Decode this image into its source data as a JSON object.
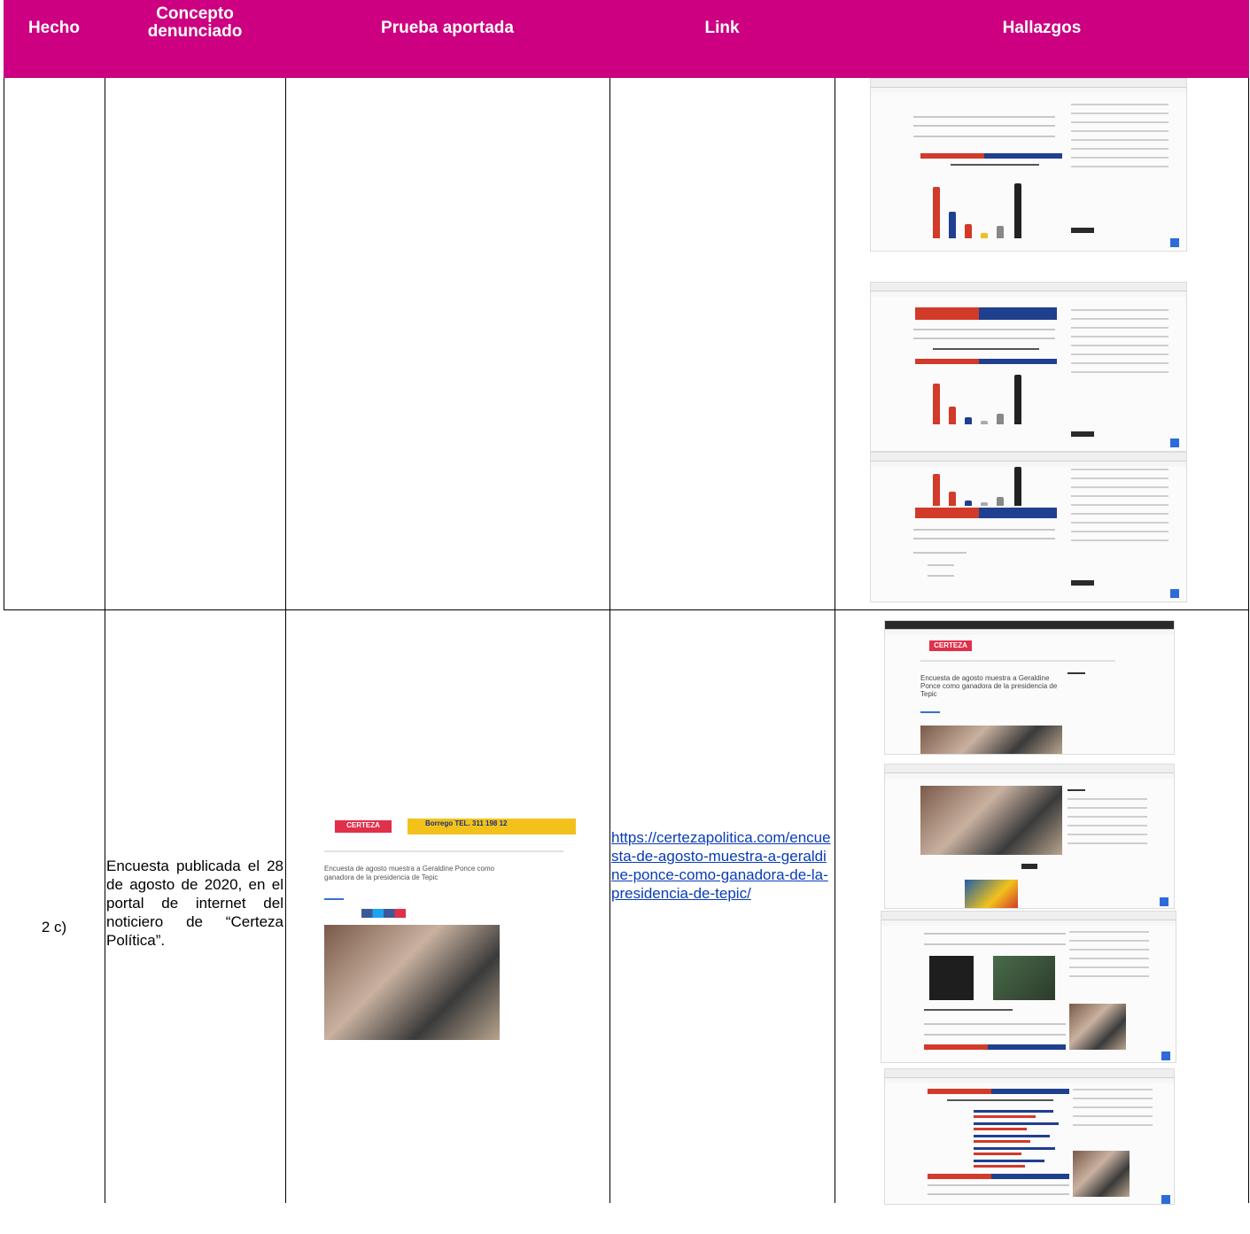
{
  "table": {
    "headers": {
      "hecho": "Hecho",
      "concepto_l1": "Concepto",
      "concepto_l2": "denunciado",
      "prueba": "Prueba aportada",
      "link": "Link",
      "hallazgos": "Hallazgos"
    },
    "row2": {
      "hecho": "2 c)",
      "concepto": "Encuesta publicada el 28 de agosto de 2020, en el portal de internet del noticiero de “Certeza Política”.",
      "link": "https://certezapolitica.com/encuesta-de-agosto-muestra-a-geraldine-ponce-como-ganadora-de-la-presidencia-de-tepic/"
    }
  },
  "evidence": {
    "logo_text": "CERTEZA",
    "ad_text": "Borrego  TEL. 311 198 12",
    "article_title": "Encuesta de agosto muestra a Geraldine Ponce como ganadora de la presidencia de Tepic"
  },
  "colors": {
    "header_bg": "#cc0080",
    "header_text": "#ffffff",
    "link": "#0a3cb5"
  }
}
